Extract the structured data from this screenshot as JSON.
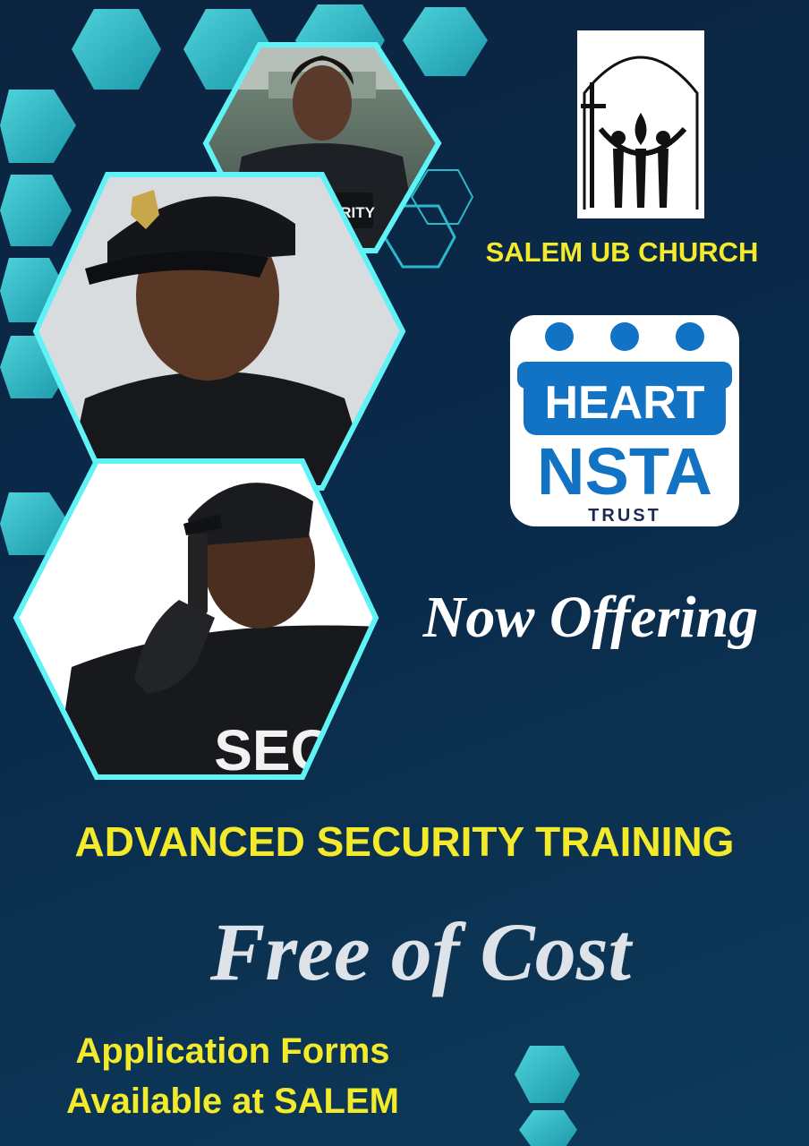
{
  "church": {
    "name": "SALEM UB CHURCH"
  },
  "partner_logo": {
    "line1": "HEART",
    "line2": "NSTA",
    "line3": "TRUST",
    "color": "#1272c4"
  },
  "photos": {
    "top_vest_text": "SECURITY",
    "bottom_shirt_text": "SEC"
  },
  "offer": {
    "intro": "Now Offering",
    "headline": "ADVANCED SECURITY TRAINING",
    "price": "Free of Cost"
  },
  "application": {
    "line1": "Application Forms",
    "line2": "Available at SALEM"
  },
  "colors": {
    "background": "#0a2a4a",
    "accent_yellow": "#f2ea2a",
    "hex_teal": "#2bb8c8",
    "frame_cyan": "#5ff2f6"
  }
}
